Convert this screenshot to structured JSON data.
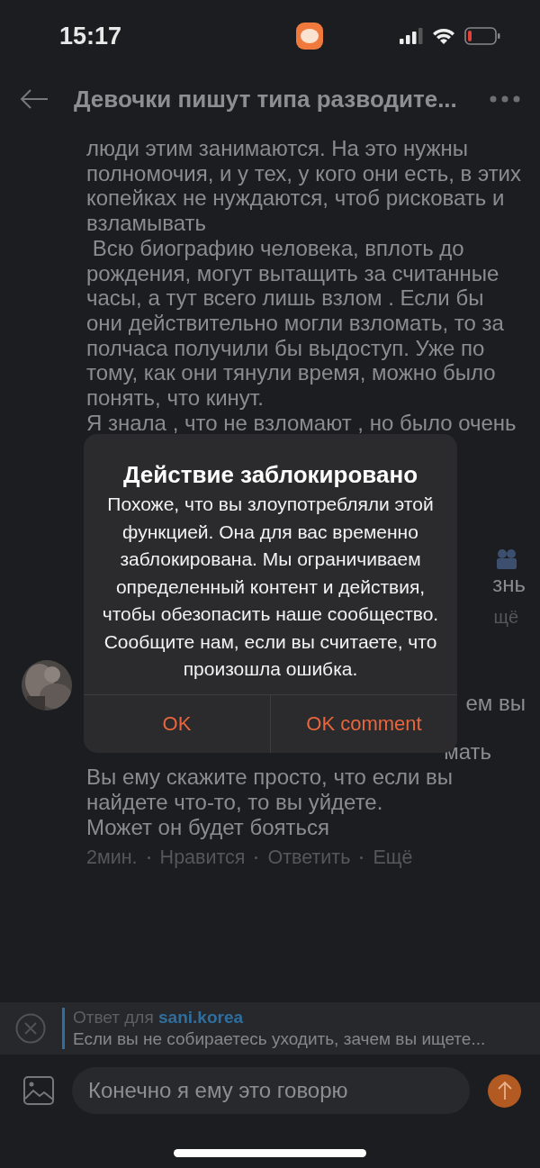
{
  "status_bar": {
    "time": "15:17",
    "battery_low": true
  },
  "header": {
    "title": "Девочки пишут типа разводите..."
  },
  "post": {
    "paragraphs": [
      "люди этим занимаются. На это нужны полномочия, и у тех, у кого они есть, в этих копейках не нуждаются, чтоб рисковать и взламывать",
      " Всю биографию человека, вплоть до рождения, могут вытащить за считанные часы, а тут всего лишь взлом . Если бы они действительно могли взломать, то за полчаса получили бы выдоступ. Уже по тому, как они тянули время, можно было понять, что кинут.",
      "Я знала , что не взломают , но было очень"
    ]
  },
  "hidden_fragments": {
    "line_end": "знь",
    "action": "щё",
    "reply_line_end": "ем вы",
    "reply_line_end_2": "мать"
  },
  "reply": {
    "paragraphs": [
      "Вы ему скажите просто, что если вы найдете что-то, то вы уйдете.",
      "Может он будет бояться"
    ],
    "meta": [
      "2мин.",
      "Нравится",
      "Ответить",
      "Ещё"
    ]
  },
  "dialog": {
    "title": "Действие заблокировано",
    "message": "Похоже, что вы злоупотребляли этой функцией. Она для вас временно заблокирована. Мы ограничиваем определенный контент и действия, чтобы обезопасить наше сообщество. Сообщите нам, если вы считаете, что произошла ошибка.",
    "buttons": [
      "OK",
      "OK comment"
    ]
  },
  "reply_bar": {
    "label": "Ответ для",
    "user": "sani.korea",
    "quote": "Если вы не собираетесь уходить, зачем вы ищете..."
  },
  "composer": {
    "value": "Конечно я ему это говорю"
  }
}
